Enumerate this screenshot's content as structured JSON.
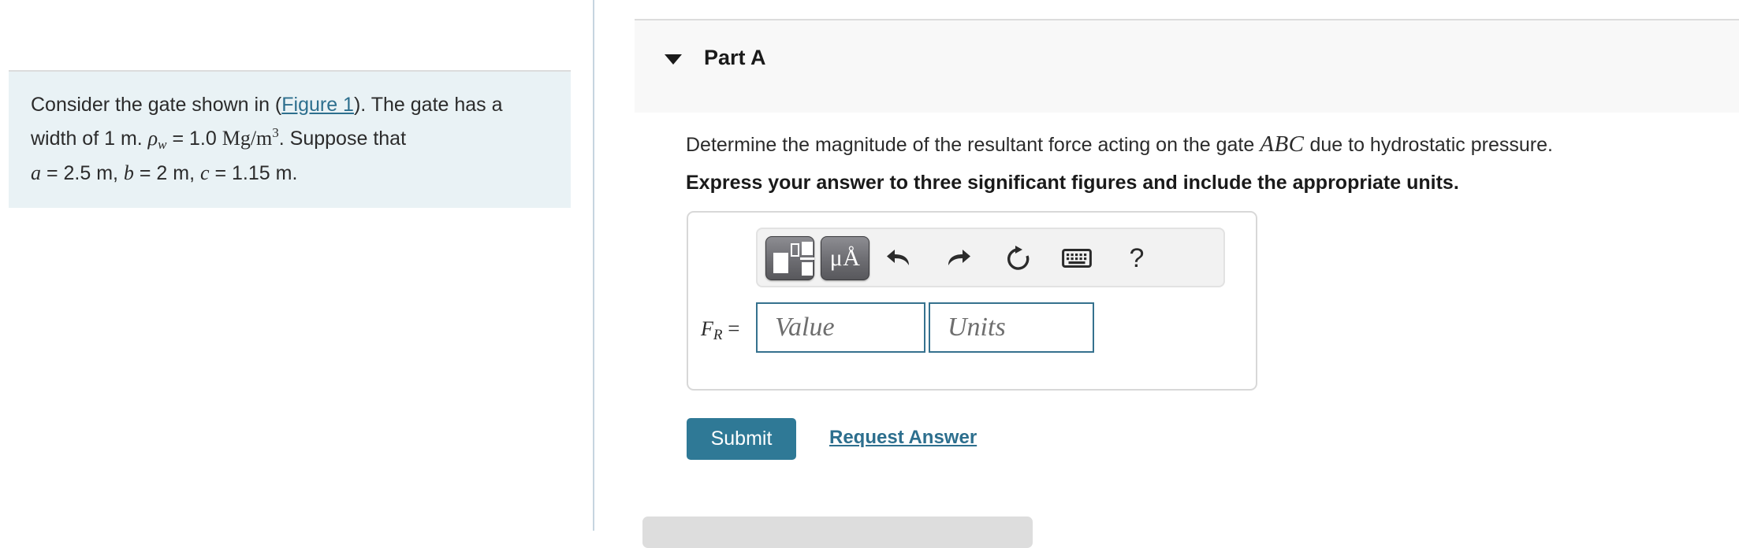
{
  "left_panel": {
    "question": {
      "line1_pre": "Consider the gate shown in (",
      "figure_link": "Figure 1",
      "line1_post": "). The gate has a",
      "line2_pre": "width of 1 m. ",
      "rho_symbol": "ρ",
      "rho_sub": "w",
      "line2_mid": " = 1.0 ",
      "unit_mg_m": "Mg/m",
      "unit_exp": "3",
      "line2_post": ". Suppose that",
      "var_a": "a",
      "val_a": " = 2.5 m, ",
      "var_b": "b",
      "val_b": " = 2 m, ",
      "var_c": "c",
      "val_c": " = 1.15 m."
    }
  },
  "right_panel": {
    "part_header": {
      "title": "Part A",
      "toggle_icon": "triangle-down-icon"
    },
    "prompt": {
      "pre": "Determine the magnitude of the resultant force acting on the gate ",
      "variable": "ABC",
      "post": " due to hydrostatic pressure."
    },
    "express_instruction": "Express your answer to three significant figures and include the appropriate units.",
    "answer_entry": {
      "toolbar": {
        "template_button": "math-template-icon",
        "units_button_label": "μÅ",
        "undo_icon": "undo-arrow-icon",
        "redo_icon": "redo-arrow-icon",
        "reset_icon": "reset-circular-arrow-icon",
        "keyboard_icon": "keyboard-icon",
        "help_icon": "?"
      },
      "label_symbol": "F",
      "label_sub": "R",
      "label_equals": " =",
      "value_placeholder": "Value",
      "units_placeholder": "Units",
      "value": "",
      "units": ""
    },
    "submit_label": "Submit",
    "request_answer_label": "Request Answer"
  },
  "colors": {
    "accent_blue": "#2f7996",
    "link_blue": "#2d6f8e",
    "question_box_bg": "#e9f2f5",
    "part_header_bg": "#f8f8f8",
    "input_border": "#35718e"
  }
}
